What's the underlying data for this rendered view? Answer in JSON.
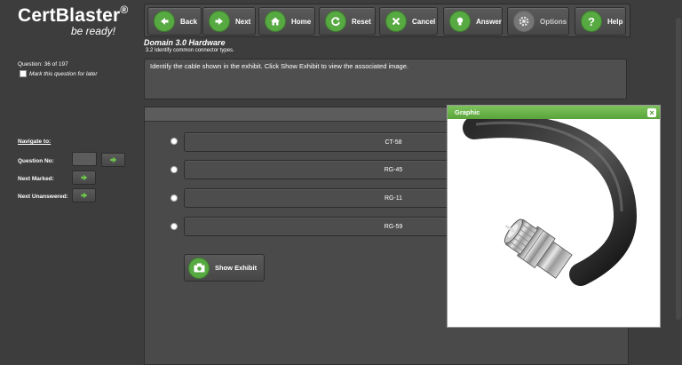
{
  "app": {
    "brand": "CertBlaster",
    "reg": "®",
    "tagline": "be ready!"
  },
  "toolbar": [
    {
      "label": "Back",
      "icon": "arrow-left-icon",
      "enabled": true
    },
    {
      "label": "Next",
      "icon": "arrow-right-icon",
      "enabled": true
    },
    {
      "label": "Home",
      "icon": "home-icon",
      "enabled": true
    },
    {
      "label": "Reset",
      "icon": "reset-icon",
      "enabled": true
    },
    {
      "label": "Cancel",
      "icon": "close-icon",
      "enabled": true
    },
    {
      "label": "Answer",
      "icon": "lightbulb-icon",
      "enabled": true
    },
    {
      "label": "Options",
      "icon": "gear-icon",
      "enabled": false
    },
    {
      "label": "Help",
      "icon": "question-icon",
      "enabled": true
    }
  ],
  "domain": {
    "title": "Domain 3.0 Hardware",
    "subtitle": "3.2 Identify common connector types."
  },
  "question": {
    "counter": "Question: 36 of 197",
    "mark_label": "Mark this question for later",
    "text": "Identify the cable shown in the exhibit. Click Show Exhibit to view the associated image."
  },
  "navigate": {
    "title": "Navigate to:",
    "question_no": "Question No:",
    "next_marked": "Next Marked:",
    "next_unanswered": "Next Unanswered:"
  },
  "options": [
    "CT-58",
    "RG-45",
    "RG-11",
    "RG-59"
  ],
  "exhibit_button": "Show Exhibit",
  "graphic": {
    "title": "Graphic",
    "close": "×"
  },
  "colors": {
    "accent": "#57a942",
    "header_green": "#6cb64a",
    "bg": "#3d3d3d"
  }
}
